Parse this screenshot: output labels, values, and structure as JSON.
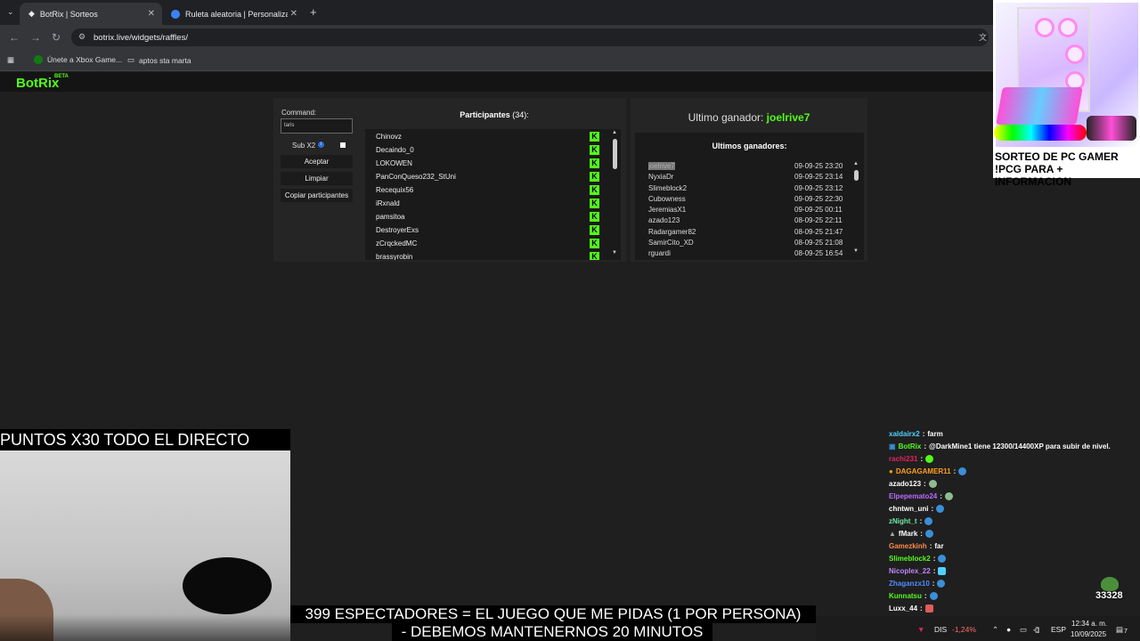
{
  "browser": {
    "tabs": [
      {
        "title": "BotRix | Sorteos",
        "active": true
      },
      {
        "title": "Ruleta aleatoria | Personaliza y",
        "active": false
      }
    ],
    "url": "botrix.live/widgets/raffles/",
    "bookmarks": [
      "Únete a Xbox Game...",
      "aptos sta marta"
    ]
  },
  "site": {
    "logo": "BotRix",
    "logo_badge": "BETA"
  },
  "raffle": {
    "command_label": "Command:",
    "command_value": "taris",
    "sub_x2_label": "Sub X2",
    "buttons": {
      "accept": "Aceptar",
      "clear": "Limpiar",
      "copy": "Copiar participantes"
    },
    "participants_title": "Participantes",
    "participants_count": "(34):",
    "participants": [
      "Chinovz",
      "Decaindo_0",
      "LOKOWEN",
      "PanConQueso232_StUni",
      "Recequix56",
      "iRxnald",
      "pamsitoa",
      "DestroyerExs",
      "zCrqckedMC",
      "brassyrobin"
    ]
  },
  "winners": {
    "last_label": "Ultimo ganador:",
    "last_name": "joelrive7",
    "history_title": "Ultimos ganadores:",
    "list": [
      {
        "name": "joelrive7",
        "date": "09-09-25 23:20"
      },
      {
        "name": "NyxiaDr",
        "date": "09-09-25 23:14"
      },
      {
        "name": "Slimeblock2",
        "date": "09-09-25 23:12"
      },
      {
        "name": "Cubowness",
        "date": "09-09-25 22:30"
      },
      {
        "name": "JeremiasX1",
        "date": "09-09-25 00:11"
      },
      {
        "name": "azado123",
        "date": "08-09-25 22:11"
      },
      {
        "name": "Radargamer82",
        "date": "08-09-25 21:47"
      },
      {
        "name": "SamirCito_XD",
        "date": "08-09-25 21:08"
      },
      {
        "name": "rguardi",
        "date": "08-09-25 16:54"
      }
    ]
  },
  "ad": {
    "line1": "SORTEO DE PC GAMER",
    "line2": "!PCG PARA + INFORMACION"
  },
  "overlay": {
    "promo": "PUNTOS X30 TODO EL DIRECTO",
    "ticker1": "399 ESPECTADORES = EL JUEGO QUE ME PIDAS (1 POR PERSONA)",
    "ticker2": "- DEBEMOS MANTENERNOS 20 MINUTOS",
    "viewer_count": "33328"
  },
  "chat": [
    {
      "user": "xaldairx2",
      "msg": "farm",
      "color": "#4fd1ff"
    },
    {
      "user": "BotRix",
      "msg": "@DarkMine1 tiene 12300/14400XP para subir de nivel.",
      "color": "#53fc18"
    },
    {
      "user": "rachi231",
      "msg": "",
      "color": "#e0245e"
    },
    {
      "user": "DAGAGAMER11",
      "msg": "",
      "color": "#ff9f1a"
    },
    {
      "user": "azado123",
      "msg": "",
      "color": "#ffffff"
    },
    {
      "user": "Elpepemato24",
      "msg": "",
      "color": "#b86bff"
    },
    {
      "user": "chntwn_uni",
      "msg": "",
      "color": "#ffffff"
    },
    {
      "user": "zNight_t",
      "msg": "",
      "color": "#6ee6a8"
    },
    {
      "user": "fMark",
      "msg": "",
      "color": "#ffffff"
    },
    {
      "user": "Gamezkinh",
      "msg": "far",
      "color": "#ff8a4a"
    },
    {
      "user": "Slimeblock2",
      "msg": "",
      "color": "#53fc18"
    },
    {
      "user": "Nicoplex_22",
      "msg": "",
      "color": "#c084fc"
    },
    {
      "user": "Zhaganzx10",
      "msg": "",
      "color": "#4f8bff"
    },
    {
      "user": "Kunnatsu",
      "msg": "",
      "color": "#53fc18"
    },
    {
      "user": "Luxx_44",
      "msg": "",
      "color": "#ffffff"
    }
  ],
  "taskbar": {
    "ticker": "DIS",
    "change": "-1,24%",
    "lang": "ESP",
    "time": "12:34 a. m.",
    "date": "10/09/2025",
    "notifications": "7"
  }
}
